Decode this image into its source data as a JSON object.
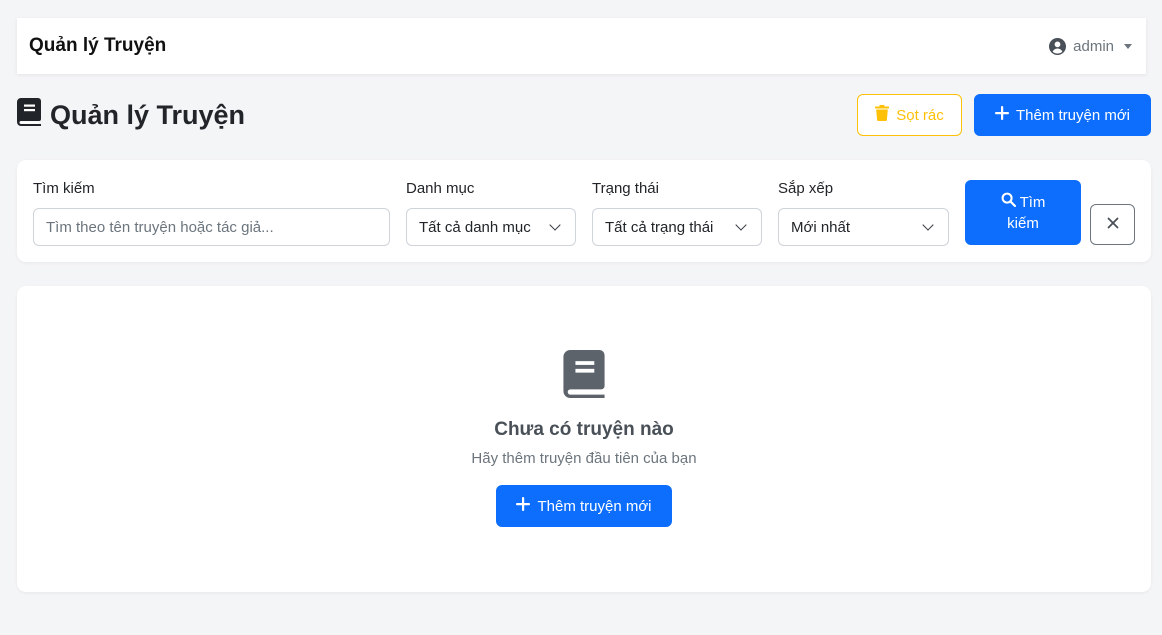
{
  "navbar": {
    "brand": "Quản lý Truyện",
    "user": "admin"
  },
  "page": {
    "title": "Quản lý Truyện",
    "trash_label": "Sọt rác",
    "add_label": "Thêm truyện mới"
  },
  "filters": {
    "search": {
      "label": "Tìm kiếm",
      "placeholder": "Tìm theo tên truyện hoặc tác giả..."
    },
    "category": {
      "label": "Danh mục",
      "value": "Tất cả danh mục"
    },
    "status": {
      "label": "Trạng thái",
      "value": "Tất cả trạng thái"
    },
    "sort": {
      "label": "Sắp xếp",
      "value": "Mới nhất"
    },
    "search_button": {
      "line1": "Tìm",
      "line2": "kiếm"
    }
  },
  "empty": {
    "title": "Chưa có truyện nào",
    "subtitle": "Hãy thêm truyện đầu tiên của bạn",
    "add_label": "Thêm truyện mới"
  },
  "colors": {
    "primary": "#0d6efd",
    "warning": "#ffc107",
    "secondary": "#6c757d"
  },
  "icons": [
    "user-circle-icon",
    "book-icon",
    "trash-icon",
    "plus-icon",
    "search-icon",
    "close-icon",
    "chevron-down-icon"
  ]
}
